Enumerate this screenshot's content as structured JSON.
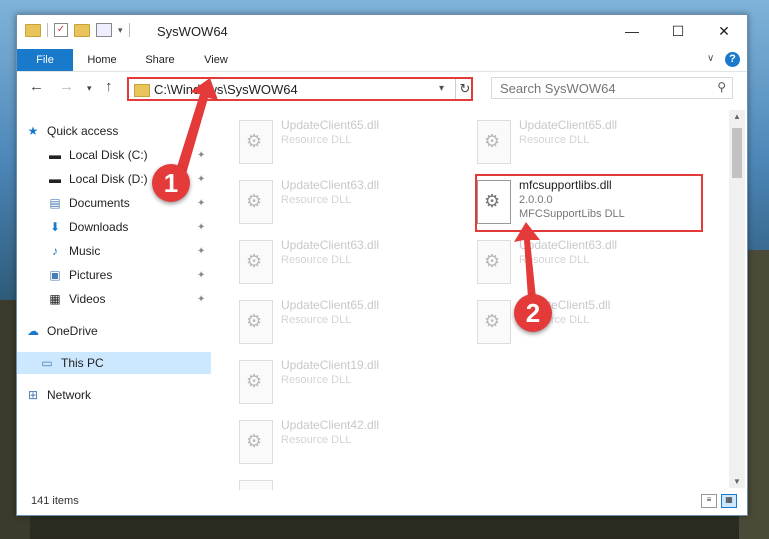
{
  "window": {
    "title": "SysWOW64",
    "minimize": "—",
    "maximize": "☐",
    "close": "✕"
  },
  "ribbon": {
    "tabs": [
      "File",
      "Home",
      "Share",
      "View"
    ],
    "help": "?"
  },
  "address": {
    "path": "C:\\Windows\\SysWOW64",
    "refresh": "↻"
  },
  "search": {
    "placeholder": "Search SysWOW64"
  },
  "nav": {
    "items": [
      {
        "label": "Quick access",
        "icon": "star-icon",
        "pinned": false
      },
      {
        "label": "Local Disk (C:)",
        "icon": "disk-icon",
        "pinned": true
      },
      {
        "label": "Local Disk (D:)",
        "icon": "disk-icon",
        "pinned": true
      },
      {
        "label": "Documents",
        "icon": "documents-icon",
        "pinned": true
      },
      {
        "label": "Downloads",
        "icon": "download-icon",
        "pinned": true
      },
      {
        "label": "Music",
        "icon": "music-icon",
        "pinned": true
      },
      {
        "label": "Pictures",
        "icon": "pictures-icon",
        "pinned": true
      },
      {
        "label": "Videos",
        "icon": "videos-icon",
        "pinned": true
      },
      {
        "label": "OneDrive",
        "icon": "cloud-icon",
        "pinned": false
      },
      {
        "label": "This PC",
        "icon": "computer-icon",
        "pinned": false,
        "selected": true
      },
      {
        "label": "Network",
        "icon": "network-icon",
        "pinned": false
      }
    ]
  },
  "files": {
    "left_column": [
      {
        "name": "UpdateClient65.dll",
        "desc": "Resource DLL"
      },
      {
        "name": "UpdateClient63.dll",
        "desc": "Resource DLL"
      },
      {
        "name": "UpdateClient63.dll",
        "desc": "Resource DLL"
      },
      {
        "name": "UpdateClient65.dll",
        "desc": "Resource DLL"
      },
      {
        "name": "UpdateClient19.dll",
        "desc": "Resource DLL"
      },
      {
        "name": "UpdateClient42.dll",
        "desc": "Resource DLL"
      },
      {
        "name": "",
        "desc": ""
      }
    ],
    "right_column": [
      {
        "name": "UpdateClient65.dll",
        "desc": "Resource DLL"
      },
      {
        "name": "UpdateClient63.dll",
        "desc": "Resource DLL"
      },
      {
        "name": "UpdateClient5.dll",
        "desc": "Resource DLL"
      }
    ],
    "highlighted": {
      "name": "mfcsupportlibs.dll",
      "version": "2.0.0.0",
      "desc": "MFCSupportLibs DLL"
    }
  },
  "status": {
    "count": "141 items"
  },
  "markers": {
    "one": "1",
    "two": "2"
  },
  "colors": {
    "accent": "#1979ca",
    "highlight": "#e53a3a",
    "selected": "#cce8ff"
  }
}
